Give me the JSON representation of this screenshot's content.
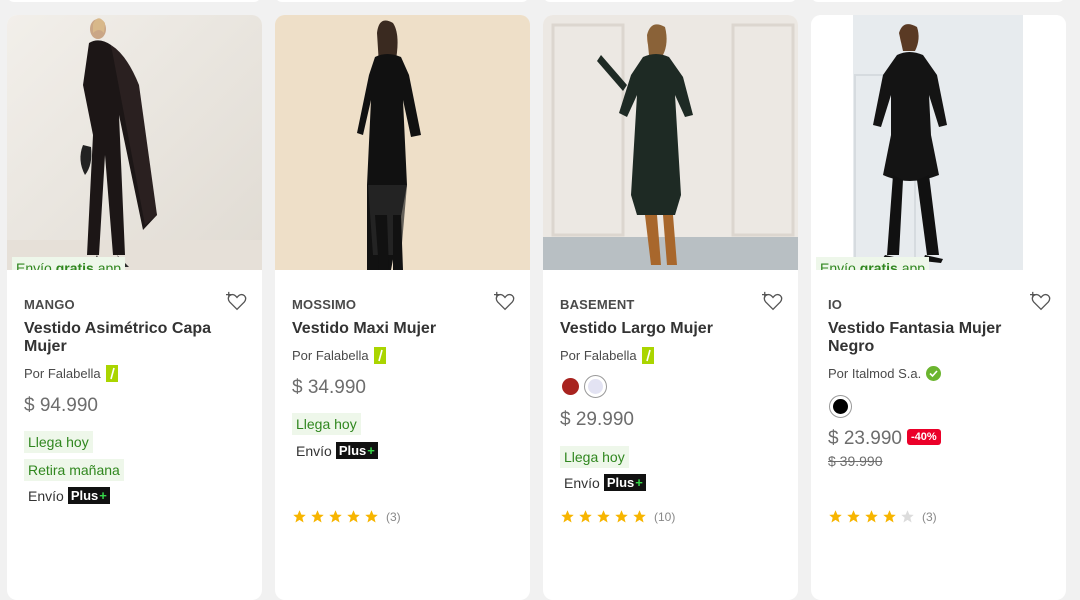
{
  "envio_gratis": {
    "prefix": "Envío",
    "bold": "gratis",
    "suffix": "app"
  },
  "envio_plus": {
    "prefix": "Envío",
    "plus": "Plus",
    "plus_sign": "+"
  },
  "products": [
    {
      "brand": "MANGO",
      "title": "Vestido Asimétrico Capa Mujer",
      "seller": "Por Falabella",
      "seller_badge": "falabella-icon",
      "price": "$ 94.990",
      "tags": [
        "Llega hoy",
        "Retira mañana"
      ],
      "envio_plus": true,
      "envio_gratis": true
    },
    {
      "brand": "MOSSIMO",
      "title": "Vestido Maxi Mujer",
      "seller": "Por Falabella",
      "seller_badge": "falabella-icon",
      "price": "$ 34.990",
      "tags": [
        "Llega hoy"
      ],
      "envio_plus": true,
      "rating": 5,
      "reviews": "(3)"
    },
    {
      "brand": "BASEMENT",
      "title": "Vestido Largo Mujer",
      "seller": "Por Falabella",
      "seller_badge": "falabella-icon",
      "swatches": [
        "#a8231f",
        "#e3e3f3"
      ],
      "price": "$ 29.990",
      "tags": [
        "Llega hoy"
      ],
      "envio_plus": true,
      "rating": 5,
      "reviews": "(10)"
    },
    {
      "brand": "IO",
      "title": "Vestido Fantasia Mujer Negro",
      "seller": "Por Italmod S.a.",
      "seller_badge": "verified-icon",
      "swatches": [
        "#000000"
      ],
      "price": "$ 23.990",
      "discount": "-40%",
      "old_price": "$ 39.990",
      "rating": 4,
      "reviews": "(3)",
      "envio_gratis": true
    }
  ],
  "colors": {
    "green": "#30871f",
    "green_bg": "#eef7ea",
    "discount": "#eb0029",
    "star": "#f7b500",
    "falabella": "#aad500"
  }
}
